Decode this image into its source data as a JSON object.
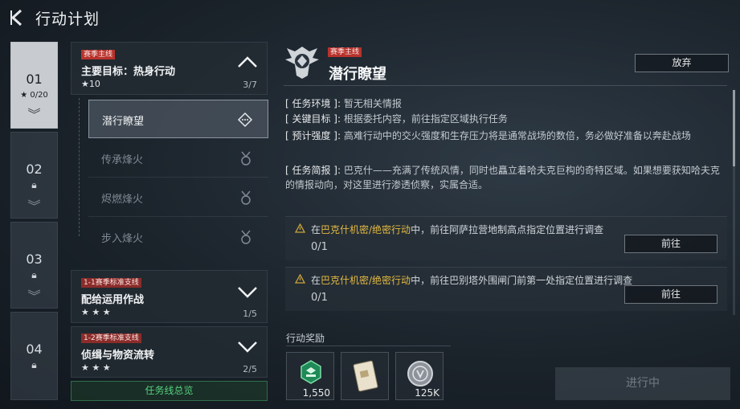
{
  "header": {
    "title": "行动计划"
  },
  "chapters": [
    {
      "num": "01",
      "stars": "★ 0/20"
    },
    {
      "num": "02"
    },
    {
      "num": "03"
    },
    {
      "num": "04"
    }
  ],
  "main_mission": {
    "tag": "赛季主线",
    "title": "主要目标：热身行动",
    "stars": "★10",
    "count": "3/7",
    "items": [
      "潜行瞭望",
      "传承烽火",
      "烬燃烽火",
      "步入烽火"
    ]
  },
  "side_missions": [
    {
      "tag": "1-1赛季标准支线",
      "title": "配给运用作战",
      "stars": "★ ★ ★",
      "count": "1/5"
    },
    {
      "tag": "1-2赛季标准支线",
      "title": "侦缉与物资流转",
      "stars": "★ ★ ★",
      "count": "2/5"
    }
  ],
  "overview_label": "任务线总览",
  "detail": {
    "tag": "赛季主线",
    "title": "潜行瞭望",
    "abandon_label": "放弃",
    "env_key": "[ 任务环境 ]:",
    "env_val": "暂无相关情报",
    "goal_key": "[ 关键目标 ]:",
    "goal_val": "根据委托内容，前往指定区域执行任务",
    "intensity_key": "[ 预计强度 ]:",
    "intensity_val": "高难行动中的交火强度和生存压力将是通常战场的数倍，务必做好准备以奔赴战场",
    "brief_key": "[ 任务简报 ]:",
    "brief_val": "巴克什——充满了传统风情，同时也矗立着哈夫克巨构的奇特区域。如果想要获知哈夫克的情报动向，对这里进行渗透侦察，实属合适。"
  },
  "tasks": [
    {
      "pre": "在",
      "hl": "巴克什机密/绝密行动",
      "post": "中，前往阿萨拉营地制高点指定位置进行调查",
      "progress": "0/1",
      "go_label": "前往"
    },
    {
      "pre": "在",
      "hl": "巴克什机密/绝密行动",
      "post": "中，前往巴别塔外围闸门前第一处指定位置进行调查",
      "progress": "0/1",
      "go_label": "前往"
    }
  ],
  "rewards_label": "行动奖励",
  "rewards": [
    {
      "icon": "green-badge-icon",
      "qty": "1,550"
    },
    {
      "icon": "card-item-icon",
      "qty": ""
    },
    {
      "icon": "silver-coin-icon",
      "qty": "125K"
    }
  ],
  "action_label": "进行中",
  "colors": {
    "highlight": "#e4b940",
    "tag_red": "#b8322c",
    "overview_green": "#55d07e"
  }
}
